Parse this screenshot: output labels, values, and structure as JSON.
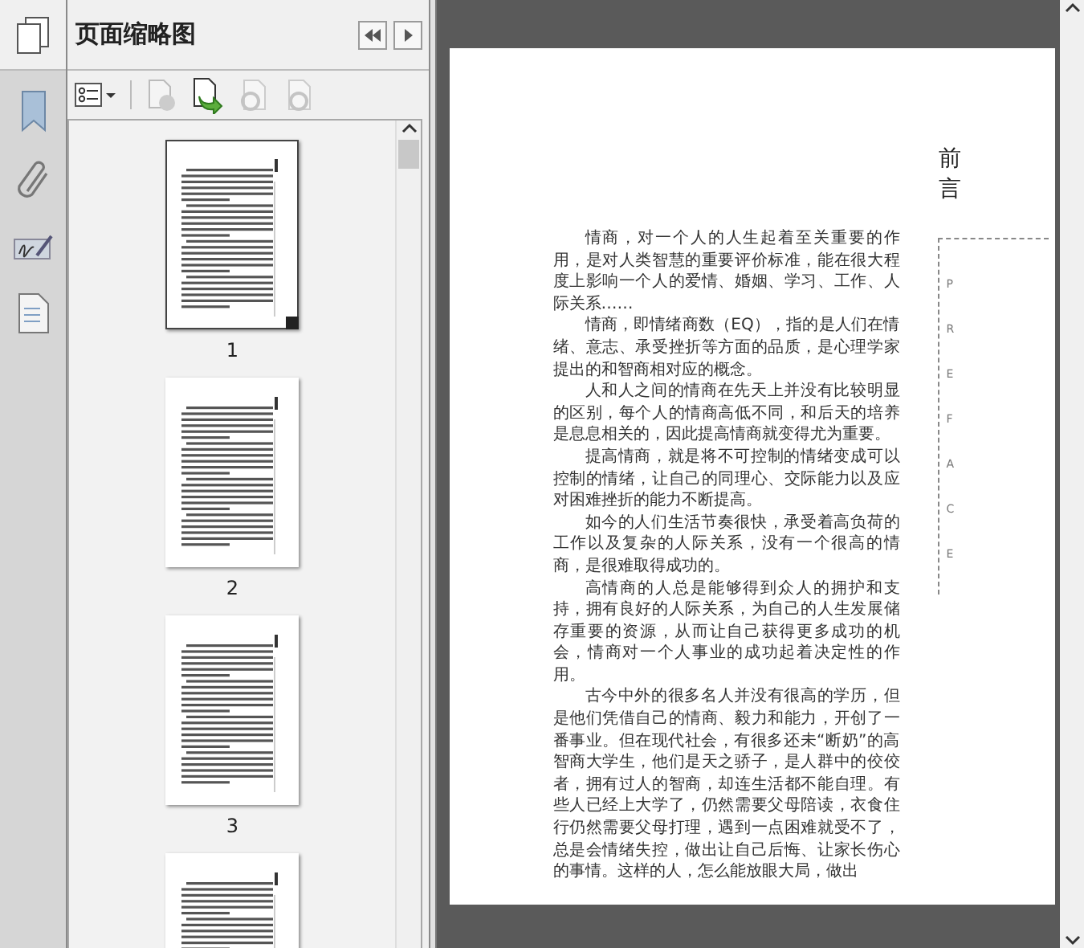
{
  "panel": {
    "title": "页面缩略图"
  },
  "thumbnails": [
    {
      "label": "1",
      "selected": true
    },
    {
      "label": "2",
      "selected": false
    },
    {
      "label": "3",
      "selected": false
    },
    {
      "selected": false
    }
  ],
  "document": {
    "heading": "前言",
    "side_label": "PREFACE",
    "paragraphs": [
      "情商，对一个人的人生起着至关重要的作用，是对人类智慧的重要评价标准，能在很大程度上影响一个人的爱情、婚姻、学习、工作、人际关系……",
      "情商，即情绪商数（EQ），指的是人们在情绪、意志、承受挫折等方面的品质，是心理学家提出的和智商相对应的概念。",
      "人和人之间的情商在先天上并没有比较明显的区别，每个人的情商高低不同，和后天的培养是息息相关的，因此提高情商就变得尤为重要。",
      "提高情商，就是将不可控制的情绪变成可以控制的情绪，让自己的同理心、交际能力以及应对困难挫折的能力不断提高。",
      "如今的人们生活节奏很快，承受着高负荷的工作以及复杂的人际关系，没有一个很高的情商，是很难取得成功的。",
      "高情商的人总是能够得到众人的拥护和支持，拥有良好的人际关系，为自己的人生发展储存重要的资源，从而让自己获得更多成功的机会，情商对一个人事业的成功起着决定性的作用。",
      "古今中外的很多名人并没有很高的学历，但是他们凭借自己的情商、毅力和能力，开创了一番事业。但在现代社会，有很多还未“断奶”的高智商大学生，他们是天之骄子，是人群中的佼佼者，拥有过人的智商，却连生活都不能自理。有些人已经上大学了，仍然需要父母陪读，衣食住行仍然需要父母打理，遇到一点困难就受不了，总是会情绪失控，做出让自己后悔、让家长伤心的事情。这样的人，怎么能放眼大局，做出"
    ]
  }
}
